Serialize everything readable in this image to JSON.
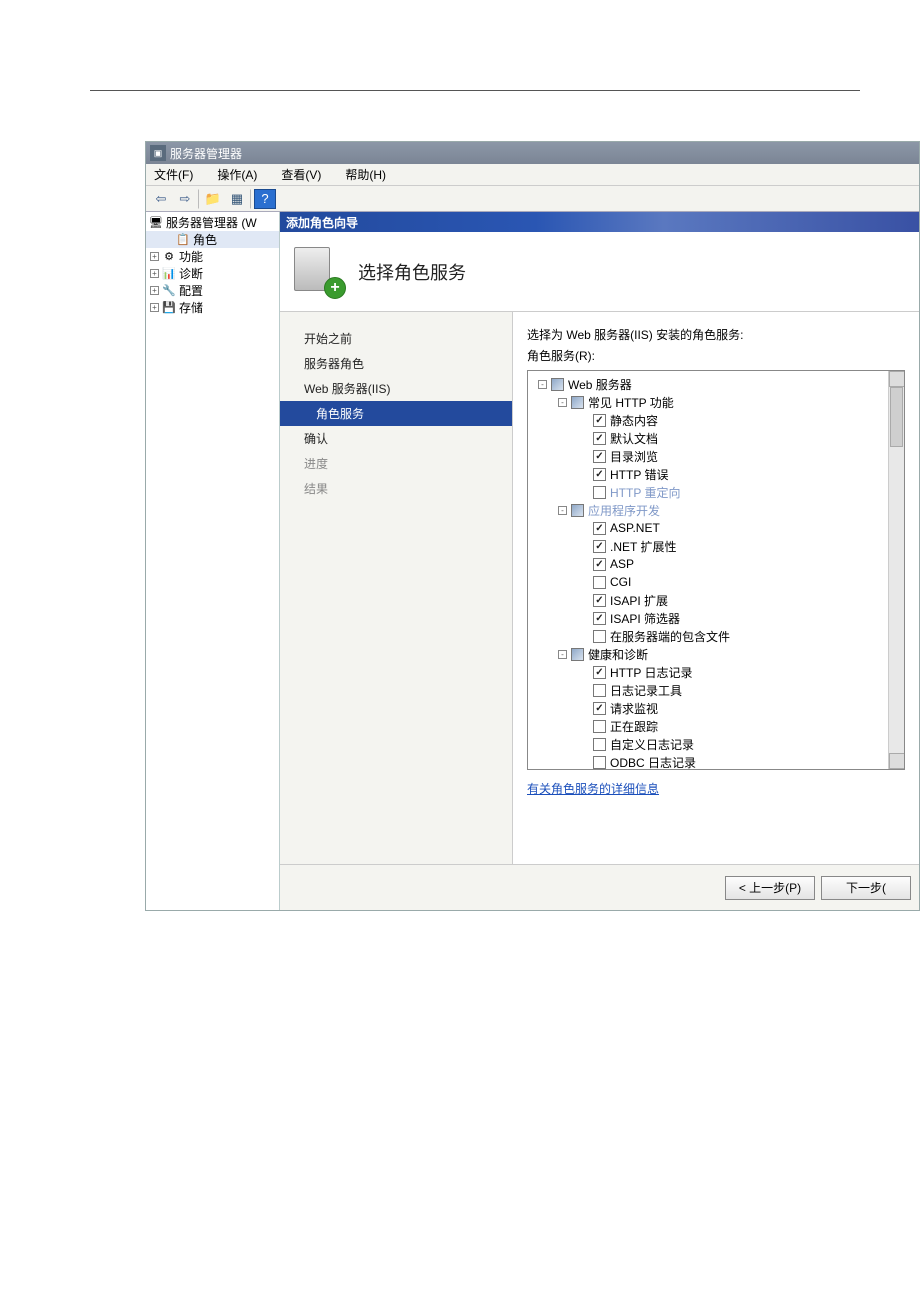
{
  "window_title": "服务器管理器",
  "menu": {
    "file": "文件(F)",
    "action": "操作(A)",
    "view": "查看(V)",
    "help": "帮助(H)"
  },
  "sidebar": {
    "root": "服务器管理器 (W",
    "items": [
      {
        "label": "角色",
        "selected": true
      },
      {
        "label": "功能"
      },
      {
        "label": "诊断"
      },
      {
        "label": "配置"
      },
      {
        "label": "存储"
      }
    ]
  },
  "wizard": {
    "title": "添加角色向导",
    "heading": "选择角色服务",
    "nav": [
      {
        "label": "开始之前"
      },
      {
        "label": "服务器角色"
      },
      {
        "label": "Web 服务器(IIS)"
      },
      {
        "label": "角色服务",
        "selected": true
      },
      {
        "label": "确认"
      },
      {
        "label": "进度",
        "dim": true
      },
      {
        "label": "结果",
        "dim": true
      }
    ],
    "prompt": "选择为 Web 服务器(IIS) 安装的角色服务:",
    "sublabel": "角色服务(R):",
    "tree": [
      {
        "d": 1,
        "exp": "-",
        "chk": "tri",
        "label": "Web 服务器"
      },
      {
        "d": 2,
        "exp": "-",
        "chk": "tri",
        "label": "常见 HTTP 功能"
      },
      {
        "d": 3,
        "chk": "on",
        "label": "静态内容"
      },
      {
        "d": 3,
        "chk": "on",
        "label": "默认文档"
      },
      {
        "d": 3,
        "chk": "on",
        "label": "目录浏览"
      },
      {
        "d": 3,
        "chk": "on",
        "label": "HTTP 错误"
      },
      {
        "d": 3,
        "chk": "off",
        "label": "HTTP 重定向",
        "wm": "bbs.winos.cn"
      },
      {
        "d": 2,
        "exp": "-",
        "chk": "tri",
        "label": "应用程序开发",
        "wm": "Winos技术论坛"
      },
      {
        "d": 3,
        "chk": "on",
        "label": "ASP.NET"
      },
      {
        "d": 3,
        "chk": "on",
        "label": ".NET 扩展性"
      },
      {
        "d": 3,
        "chk": "on",
        "label": "ASP"
      },
      {
        "d": 3,
        "chk": "off",
        "label": "CGI"
      },
      {
        "d": 3,
        "chk": "on",
        "label": "ISAPI 扩展"
      },
      {
        "d": 3,
        "chk": "on",
        "label": "ISAPI 筛选器"
      },
      {
        "d": 3,
        "chk": "off",
        "label": "在服务器端的包含文件"
      },
      {
        "d": 2,
        "exp": "-",
        "chk": "tri",
        "label": "健康和诊断"
      },
      {
        "d": 3,
        "chk": "on",
        "label": "HTTP 日志记录"
      },
      {
        "d": 3,
        "chk": "off",
        "label": "日志记录工具"
      },
      {
        "d": 3,
        "chk": "on",
        "label": "请求监视"
      },
      {
        "d": 3,
        "chk": "off",
        "label": "正在跟踪"
      },
      {
        "d": 3,
        "chk": "off",
        "label": "自定义日志记录"
      },
      {
        "d": 3,
        "chk": "off",
        "label": "ODBC 日志记录"
      }
    ],
    "more_link": "有关角色服务的详细信息",
    "buttons": {
      "prev": "< 上一步(P)",
      "next": "下一步("
    }
  }
}
